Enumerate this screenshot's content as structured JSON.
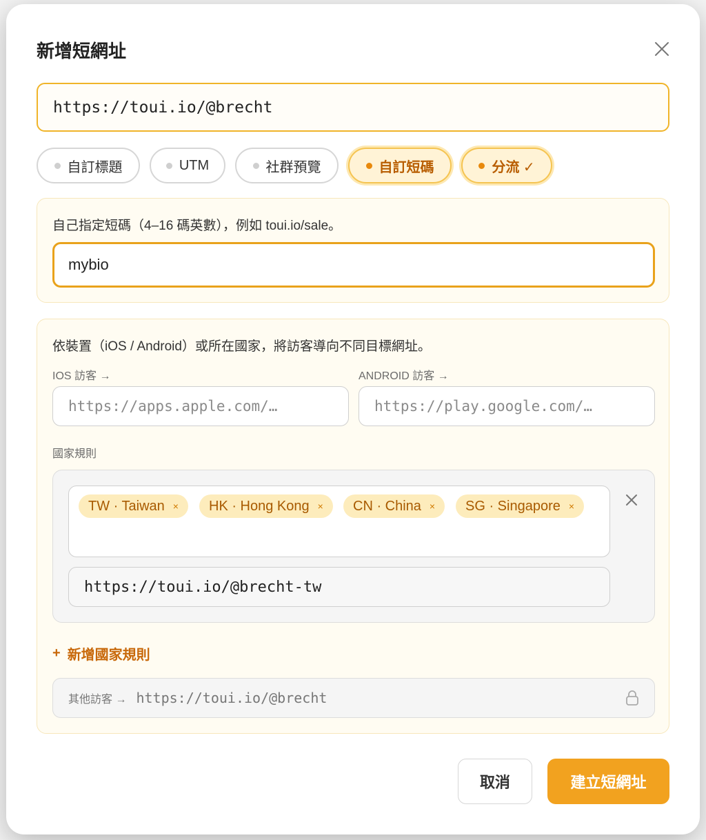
{
  "dialog": {
    "title": "新增短網址",
    "target_url": "https://toui.io/@brecht"
  },
  "chips": [
    {
      "label": "自訂標題",
      "active": false
    },
    {
      "label": "UTM",
      "active": false
    },
    {
      "label": "社群預覽",
      "active": false
    },
    {
      "label": "自訂短碼",
      "active": true
    },
    {
      "label": "分流 ✓",
      "active": true
    }
  ],
  "custom_code": {
    "description": "自己指定短碼（4–16 碼英數），例如 toui.io/sale。",
    "value": "mybio"
  },
  "routing": {
    "description": "依裝置（iOS / Android）或所在國家，將訪客導向不同目標網址。",
    "ios_label": "IOS 訪客 →",
    "ios_placeholder": "https://apps.apple.com/…",
    "android_label": "ANDROID 訪客 →",
    "android_placeholder": "https://play.google.com/…",
    "country_rules_label": "國家規則",
    "country_tags": [
      {
        "label": "TW · Taiwan",
        "remove": "×"
      },
      {
        "label": "HK · Hong Kong",
        "remove": "×"
      },
      {
        "label": "CN · China",
        "remove": "×"
      },
      {
        "label": "SG · Singapore",
        "remove": "×"
      }
    ],
    "rule_url": "https://toui.io/@brecht-tw",
    "add_rule_label": "新增國家規則",
    "add_rule_icon": "+",
    "fallback_label": "其他訪客 →",
    "fallback_url": "https://toui.io/@brecht"
  },
  "footer": {
    "cancel_label": "取消",
    "create_label": "建立短網址"
  },
  "colors": {
    "accent": "#f2a21f",
    "accent_text": "#b85d00",
    "tag_bg": "#fdecbc"
  },
  "icons": [
    "close-icon",
    "lock-icon",
    "plus-icon"
  ]
}
